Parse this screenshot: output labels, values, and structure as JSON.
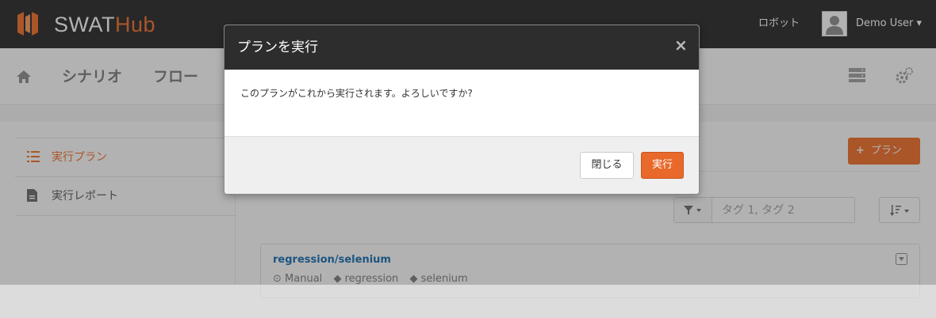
{
  "header": {
    "brand_part1": "SWAT",
    "brand_part2": "Hub",
    "robot_link": "ロボット",
    "user_name": "Demo User ▾"
  },
  "nav": {
    "tabs": [
      "シナリオ",
      "フロー"
    ],
    "icons": [
      "home-icon",
      "server-icon",
      "cogs-icon"
    ]
  },
  "sidebar": {
    "items": [
      {
        "label": "実行プラン",
        "icon": "list-icon",
        "active": true
      },
      {
        "label": "実行レポート",
        "icon": "file-icon",
        "active": false
      }
    ]
  },
  "main": {
    "add_button": "プラン",
    "filter": {
      "placeholder": "タグ 1, タグ 2"
    },
    "plans": [
      {
        "title": "regression/selenium",
        "tags": [
          "Manual",
          "regression",
          "selenium"
        ]
      }
    ]
  },
  "modal": {
    "title": "プランを実行",
    "close_glyph": "×",
    "message": "このプランがこれから実行されます。よろしいですか?",
    "cancel_label": "閉じる",
    "confirm_label": "実行"
  },
  "colors": {
    "accent": "#f47c3c",
    "header_bg": "#3a3a3a",
    "modal_head": "#2d2d2d",
    "run_button": "#e8692a"
  }
}
